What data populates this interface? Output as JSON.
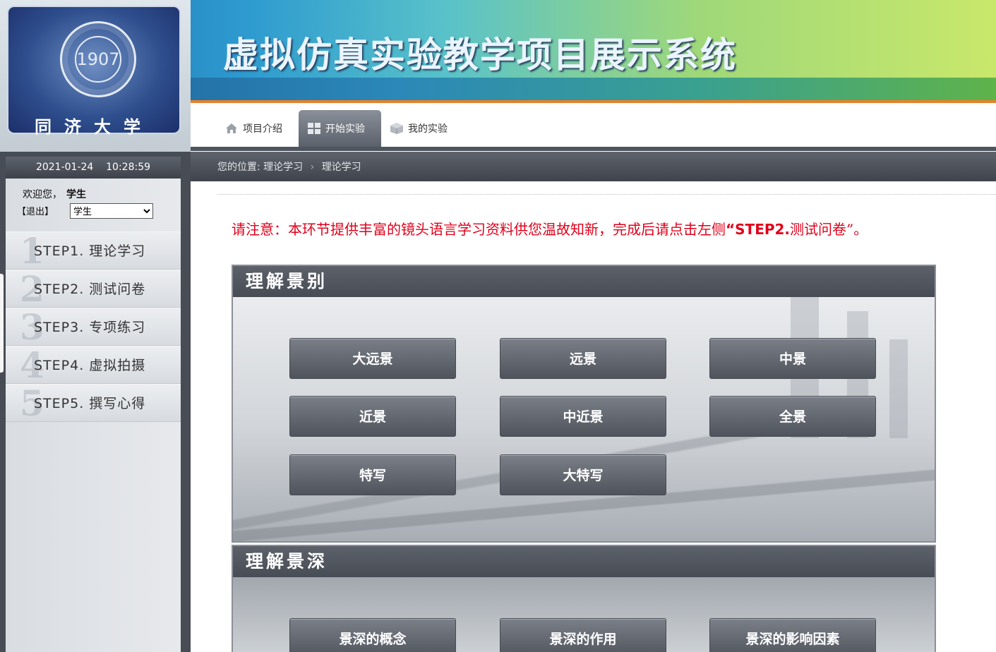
{
  "header": {
    "title": "虚拟仿真实验教学项目展示系统",
    "logo_name": "同济大学",
    "logo_year": "1907"
  },
  "topnav": {
    "items": [
      {
        "label": "项目介绍",
        "icon": "home-icon"
      },
      {
        "label": "开始实验",
        "icon": "grid-icon",
        "active": true
      },
      {
        "label": "我的实验",
        "icon": "box-icon"
      }
    ]
  },
  "sidebar": {
    "date": "2021-01-24",
    "time": "10:28:59",
    "welcome": "欢迎您，",
    "user": "学生",
    "logout": "【退出】",
    "role_selected": "学生",
    "steps": [
      {
        "num": "1",
        "label": "STEP1. 理论学习"
      },
      {
        "num": "2",
        "label": "STEP2. 测试问卷"
      },
      {
        "num": "3",
        "label": "STEP3. 专项练习"
      },
      {
        "num": "4",
        "label": "STEP4. 虚拟拍摄"
      },
      {
        "num": "5",
        "label": "STEP5. 撰写心得"
      }
    ]
  },
  "breadcrumb": {
    "prefix": "您的位置:",
    "level1": "理论学习",
    "sep": "›",
    "level2": "理论学习"
  },
  "notice": {
    "part1": "请注意：本环节提供丰富的镜头语言学习资料供您温故知新，完成后请点击左侧",
    "part2": "“STEP2.",
    "part3": "测试问卷”。"
  },
  "sections": [
    {
      "title": "理解景别",
      "buttons": [
        "大远景",
        "远景",
        "中景",
        "近景",
        "中近景",
        "全景",
        "特写",
        "大特写"
      ]
    },
    {
      "title": "理解景深",
      "buttons": [
        "景深的概念",
        "景深的作用",
        "景深的影响因素"
      ]
    }
  ],
  "colors": {
    "notice": "#e0001b",
    "accent_stripe": "#e8812b",
    "button": "#5f646c"
  }
}
